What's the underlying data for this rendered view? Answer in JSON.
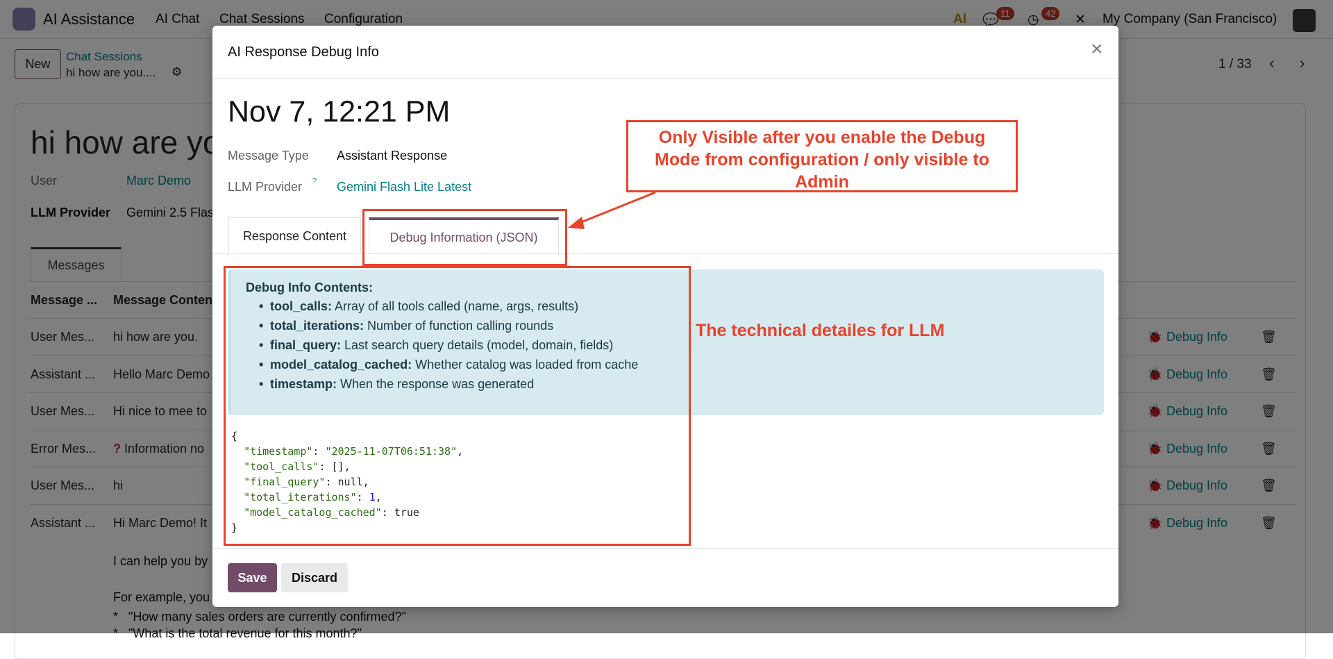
{
  "navbar": {
    "app_title": "AI Assistance",
    "menu": [
      "AI Chat",
      "Chat Sessions",
      "Configuration"
    ],
    "ai_icon_label": "AI",
    "messages_badge": "11",
    "activities_badge": "42",
    "company": "My Company (San Francisco)"
  },
  "control": {
    "new_label": "New",
    "breadcrumb_parent": "Chat Sessions",
    "breadcrumb_current": "hi how are you....",
    "pager": "1 / 33"
  },
  "form": {
    "title": "hi how are you",
    "user_label": "User",
    "user_value": "Marc Demo",
    "llm_label": "LLM Provider",
    "llm_value": "Gemini 2.5 Flas",
    "tab": "Messages",
    "columns": [
      "Message ...",
      "Message Conten"
    ],
    "rows": [
      {
        "type": "User Mes...",
        "content": "hi how are you.",
        "debug": "Debug Info"
      },
      {
        "type": "Assistant ...",
        "content": "Hello Marc Demo",
        "debug": "Debug Info"
      },
      {
        "type": "User Mes...",
        "content": "Hi nice to mee to",
        "debug": "Debug Info"
      },
      {
        "type": "Error Mes...",
        "content": "Information no",
        "debug": "Debug Info"
      },
      {
        "type": "User Mes...",
        "content": "hi",
        "debug": "Debug Info"
      },
      {
        "type": "Assistant ...",
        "content": "Hi Marc Demo! It",
        "debug": "Debug Info"
      }
    ],
    "extra_lines": [
      "I can help you by",
      "For example, you",
      "*   \"How many sales orders are currently confirmed?\"",
      "*   \"What is the total revenue for this month?\""
    ]
  },
  "modal": {
    "title": "AI Response Debug Info",
    "date": "Nov 7, 12:21 PM",
    "message_type_label": "Message Type",
    "message_type_value": "Assistant Response",
    "llm_label": "LLM Provider",
    "llm_help": "?",
    "llm_value": "Gemini Flash Lite Latest",
    "tabs": [
      "Response Content",
      "Debug Information (JSON)"
    ],
    "active_tab": "Debug Information (JSON)",
    "alert": {
      "heading": "Debug Info Contents:",
      "items": [
        {
          "key": "tool_calls:",
          "text": " Array of all tools called (name, args, results)"
        },
        {
          "key": "total_iterations:",
          "text": " Number of function calling rounds"
        },
        {
          "key": "final_query:",
          "text": " Last search query details (model, domain, fields)"
        },
        {
          "key": "model_catalog_cached:",
          "text": " Whether catalog was loaded from cache"
        },
        {
          "key": "timestamp:",
          "text": " When the response was generated"
        }
      ]
    },
    "json": {
      "open": "{",
      "close": "}",
      "lines": [
        {
          "key": "\"timestamp\"",
          "value": "\"2025-11-07T06:51:38\"",
          "tail": ","
        },
        {
          "key": "\"tool_calls\"",
          "value": "[]",
          "tail": ","
        },
        {
          "key": "\"final_query\"",
          "value": "null",
          "tail": ","
        },
        {
          "key": "\"total_iterations\"",
          "value": "1",
          "tail": ","
        },
        {
          "key": "\"model_catalog_cached\"",
          "value": "true",
          "tail": ""
        }
      ]
    },
    "save_label": "Save",
    "discard_label": "Discard"
  },
  "annotations": {
    "note1": "Only Visible after you enable the Debug Mode from configuration / only visible to Admin",
    "note2": "The technical detailes for LLM",
    "color": "#e8432b"
  },
  "colors": {
    "primary": "#714B67",
    "link": "#017e84",
    "alert_bg": "#d6eaf0"
  }
}
